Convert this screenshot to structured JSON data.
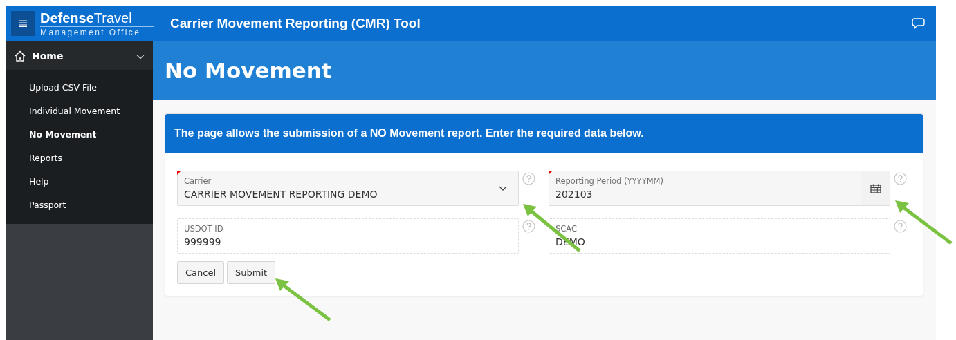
{
  "header": {
    "logo": "**Defense**Travel",
    "logo_subtitle": "Management Office",
    "title": "Carrier Movement Reporting (CMR) Tool"
  },
  "sidebar": {
    "home": {
      "label": "Home",
      "expanded": true
    },
    "items": [
      {
        "label": "Upload CSV File",
        "selected": false
      },
      {
        "label": "Individual Movement",
        "selected": false
      },
      {
        "label": "No Movement",
        "selected": true
      },
      {
        "label": "Reports",
        "selected": false
      },
      {
        "label": "Help",
        "selected": false
      },
      {
        "label": "Passport",
        "selected": false
      }
    ]
  },
  "page_title": "No Movement",
  "form": {
    "description": "The page allows the submission of a NO Movement report. Enter the required data below.",
    "fields": [
      {
        "kind": "select",
        "label": "Carrier",
        "value": "CARRIER MOVEMENT REPORTING DEMO",
        "required": true
      },
      {
        "kind": "date",
        "label": "Reporting Period (YYYYMM)",
        "value": "202103",
        "required": true
      },
      {
        "kind": "readonly",
        "label": "USDOT ID",
        "value": "999999",
        "required": false
      },
      {
        "kind": "readonly",
        "label": "SCAC",
        "value": "DEMO",
        "required": false
      }
    ],
    "buttons": [
      "Cancel",
      "Submit"
    ]
  }
}
